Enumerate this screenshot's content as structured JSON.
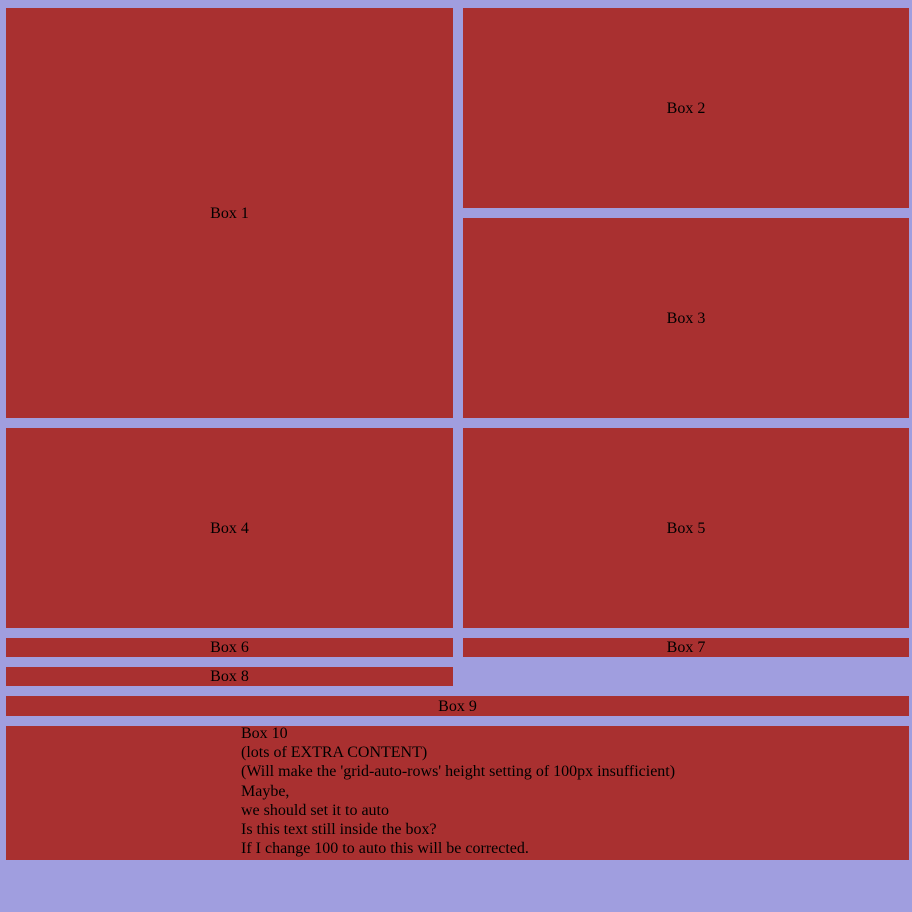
{
  "boxes": {
    "box1": "Box 1",
    "box2": "Box 2",
    "box3": "Box 3",
    "box4": "Box 4",
    "box5": "Box 5",
    "box6": "Box 6",
    "box7": "Box 7",
    "box8": "Box 8",
    "box9": "Box 9",
    "box10": {
      "lines": [
        "Box 10",
        "(lots of EXTRA CONTENT)",
        "(Will make the 'grid-auto-rows' height setting of 100px insufficient)",
        "Maybe,",
        "we should set it to auto",
        "Is this text still inside the box?",
        "If I change 100 to auto this will be corrected."
      ]
    }
  },
  "colors": {
    "background": "#a09edf",
    "box": "#a93030",
    "text": "#000000"
  }
}
